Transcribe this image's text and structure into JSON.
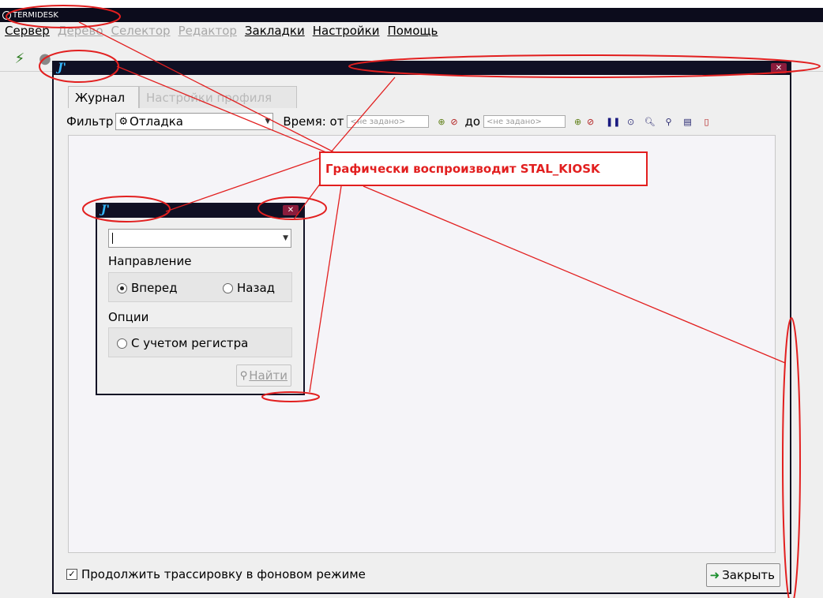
{
  "app": {
    "title": "TERMIDESK"
  },
  "menubar": {
    "items": [
      {
        "label": "Сервер",
        "enabled": true
      },
      {
        "label": "Дерево",
        "enabled": false
      },
      {
        "label": "Селектор",
        "enabled": false
      },
      {
        "label": "Редактор",
        "enabled": false
      },
      {
        "label": "Закладки",
        "enabled": true
      },
      {
        "label": "Настройки",
        "enabled": true
      },
      {
        "label": "Помощь",
        "enabled": true
      }
    ]
  },
  "toolbar": {
    "icons": [
      "connect-icon",
      "server-icon"
    ]
  },
  "journal_window": {
    "tabs": [
      {
        "label": "Журнал",
        "active": true
      },
      {
        "label": "Настройки профиля",
        "active": false
      }
    ],
    "filter_label": "Фильтр",
    "filter_value": "Отладка",
    "time_label": "Время: от",
    "time_from_placeholder": "<не задано>",
    "to_label": "до",
    "time_to_placeholder": "<не задано>",
    "continue_checkbox_label": "Продолжить трассировку в фоновом режиме",
    "continue_checked": true,
    "close_label": "Закрыть",
    "close_glyph": "✕"
  },
  "find_dialog": {
    "search_value": "",
    "direction_label": "Направление",
    "forward_label": "Вперед",
    "backward_label": "Назад",
    "direction_selected": "forward",
    "options_label": "Опции",
    "case_label": "С учетом регистра",
    "case_checked": false,
    "find_label": "Найти",
    "close_glyph": "✕"
  },
  "annotation": {
    "text": "Графически воспроизводит STAL_KIOSK",
    "color": "#e21f1f"
  }
}
